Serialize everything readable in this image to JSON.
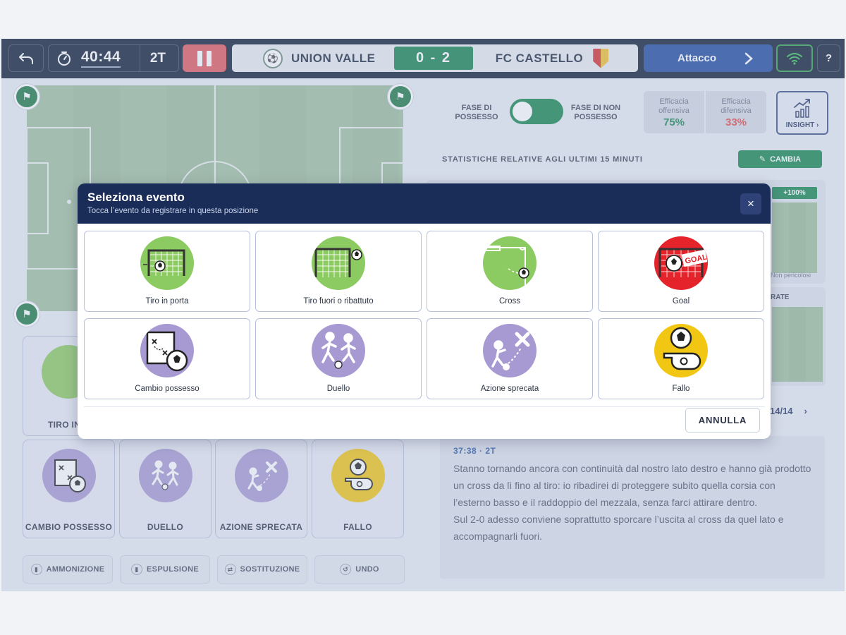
{
  "topbar": {
    "time": "40:44",
    "half": "2T",
    "home_team": "UNION VALLE",
    "score": "0 - 2",
    "away_team": "FC CASTELLO",
    "mode_label": "Attacco",
    "help_label": "?"
  },
  "right_panel": {
    "phase_possession": "FASE DI POSSESSO",
    "phase_non_possession": "FASE DI NON POSSESSO",
    "eff_off_label": "Efficacia offensiva",
    "eff_off_value": "75%",
    "eff_def_label": "Efficacia difensiva",
    "eff_def_value": "33%",
    "insight_label": "INSIGHT ›",
    "stats_label": "STATISTICHE RELATIVE AGLI ULTIMI 15 MINUTI",
    "cambia_label": "CAMBIA",
    "badge_value": "+100%",
    "non_pericolosi": "Non pericolosi",
    "rate_label": "RATE",
    "pager": "14/14",
    "note_meta": "37:38 · 2T",
    "note_text_1": "Stanno tornando ancora con continuità dal nostro lato destro e hanno già prodotto un cross da lì fino al tiro: io ribadirei di proteggere subito quella corsia con l’esterno basso e il raddoppio del mezzala, senza farci attirare dentro.",
    "note_text_2": "Sul 2-0 adesso conviene soprattutto sporcare l’uscita al cross da quel lato e accompagnarli fuori."
  },
  "left_tiles": {
    "tiro": "TIRO IN P",
    "cambio": "CAMBIO POSSESSO",
    "duello": "DUELLO",
    "azione": "AZIONE SPRECATA",
    "fallo": "FALLO"
  },
  "bottom_buttons": {
    "ammonizione": "AMMONIZIONE",
    "espulsione": "ESPULSIONE",
    "sostituzione": "SOSTITUZIONE",
    "undo": "UNDO"
  },
  "modal": {
    "title": "Seleziona evento",
    "subtitle": "Tocca l’evento da registrare in questa posizione",
    "close": "×",
    "events": [
      {
        "label": "Tiro in porta",
        "icon": "shot-on-goal-icon",
        "color": "#8ccb61"
      },
      {
        "label": "Tiro fuori o ribattuto",
        "icon": "shot-off-target-icon",
        "color": "#8ccb61"
      },
      {
        "label": "Cross",
        "icon": "cross-icon",
        "color": "#8ccb61"
      },
      {
        "label": "Goal",
        "icon": "goal-icon",
        "color": "#e5232b"
      },
      {
        "label": "Cambio possesso",
        "icon": "possession-change-icon",
        "color": "#a79ad2"
      },
      {
        "label": "Duello",
        "icon": "duel-icon",
        "color": "#a79ad2"
      },
      {
        "label": "Azione sprecata",
        "icon": "wasted-action-icon",
        "color": "#a79ad2"
      },
      {
        "label": "Fallo",
        "icon": "foul-whistle-icon",
        "color": "#f2c713"
      }
    ],
    "goal_text": "GOAL!",
    "cancel_label": "ANNULLA"
  }
}
